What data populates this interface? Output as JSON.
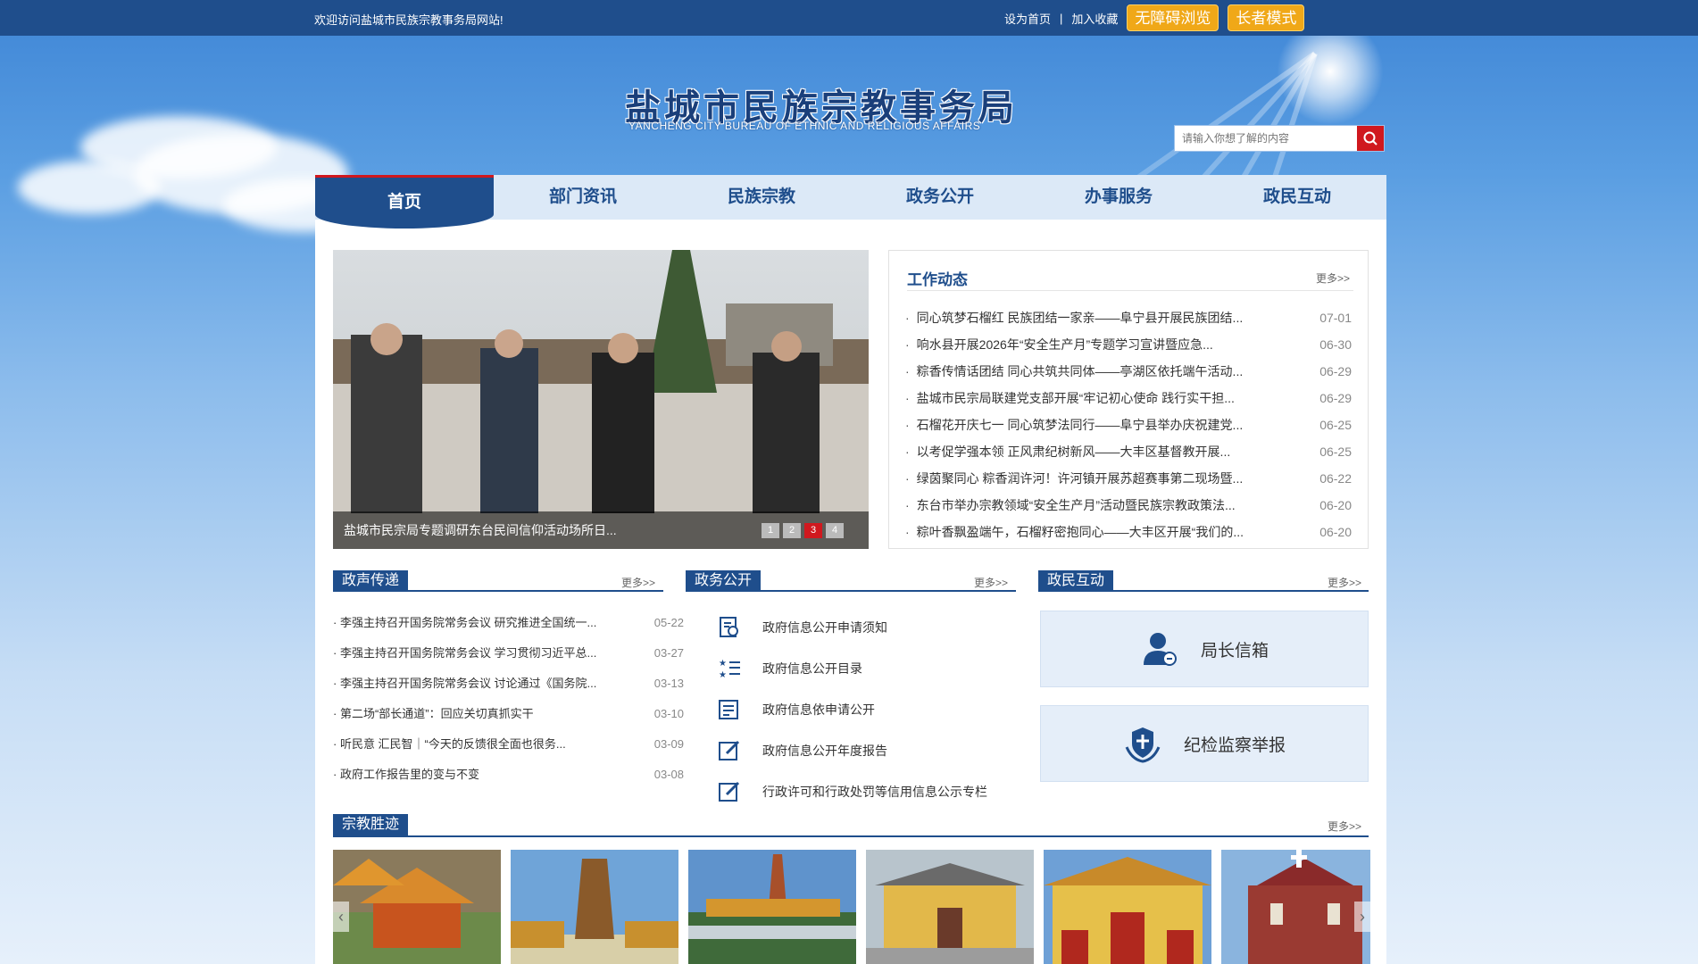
{
  "topbar": {
    "welcome": "欢迎访问盐城市民族宗教事务局网站!",
    "set_home": "设为首页",
    "separator": "|",
    "add_favorite": "加入收藏",
    "accessible_browse": "无障碍浏览",
    "elder_mode": "长者模式"
  },
  "header": {
    "title": "盐城市民族宗教事务局",
    "subtitle": "YANCHENG CITY BUREAU OF ETHNIC AND RELIGIOUS AFFAIRS",
    "search_placeholder": "请输入你想了解的内容"
  },
  "nav": [
    {
      "label": "首页",
      "active": true
    },
    {
      "label": "部门资讯",
      "active": false
    },
    {
      "label": "民族宗教",
      "active": false
    },
    {
      "label": "政务公开",
      "active": false
    },
    {
      "label": "办事服务",
      "active": false
    },
    {
      "label": "政民互动",
      "active": false
    }
  ],
  "slider": {
    "caption": "盐城市民宗局专题调研东台民间信仰活动场所日...",
    "pages": [
      "1",
      "2",
      "3",
      "4"
    ],
    "current": 3
  },
  "work_news": {
    "title": "工作动态",
    "more": "更多>>",
    "items": [
      {
        "title": "同心筑梦石榴红 民族团结一家亲——阜宁县开展民族团结...",
        "date": "07-01"
      },
      {
        "title": "响水县开展2026年“安全生产月”专题学习宣讲暨应急...",
        "date": "06-30"
      },
      {
        "title": "粽香传情话团结 同心共筑共同体——亭湖区依托端午活动...",
        "date": "06-29"
      },
      {
        "title": "盐城市民宗局联建党支部开展“牢记初心使命 践行实干担...",
        "date": "06-29"
      },
      {
        "title": "石榴花开庆七一 同心筑梦法同行——阜宁县举办庆祝建党...",
        "date": "06-25"
      },
      {
        "title": "以考促学强本领 正风肃纪树新风——大丰区基督教开展...",
        "date": "06-25"
      },
      {
        "title": "绿茵聚同心 粽香润许河！许河镇开展苏超赛事第二现场暨...",
        "date": "06-22"
      },
      {
        "title": "东台市举办宗教领域“安全生产月”活动暨民族宗教政策法...",
        "date": "06-20"
      },
      {
        "title": "粽叶香飘盈端午，石榴籽密抱同心——大丰区开展“我们的...",
        "date": "06-20"
      }
    ]
  },
  "gov_voice": {
    "title": "政声传递",
    "more": "更多>>",
    "items": [
      {
        "title": "· 李强主持召开国务院常务会议 研究推进全国统一...",
        "date": "05-22"
      },
      {
        "title": "· 李强主持召开国务院常务会议 学习贯彻习近平总...",
        "date": "03-27"
      },
      {
        "title": "· 李强主持召开国务院常务会议 讨论通过《国务院...",
        "date": "03-13"
      },
      {
        "title": "· 第二场“部长通道”：回应关切真抓实干",
        "date": "03-10"
      },
      {
        "title": "· 听民意 汇民智｜“今天的反馈很全面也很务...",
        "date": "03-09"
      },
      {
        "title": "· 政府工作报告里的变与不变",
        "date": "03-08"
      }
    ]
  },
  "gov_open": {
    "title": "政务公开",
    "more": "更多>>",
    "items": [
      {
        "label": "政府信息公开申请须知",
        "icon": "document-icon"
      },
      {
        "label": "政府信息公开目录",
        "icon": "list-icon"
      },
      {
        "label": "政府信息依申请公开",
        "icon": "form-icon"
      },
      {
        "label": "政府信息公开年度报告",
        "icon": "edit-icon"
      },
      {
        "label": "行政许可和行政处罚等信用信息公示专栏",
        "icon": "edit-icon"
      }
    ]
  },
  "interaction": {
    "title": "政民互动",
    "more": "更多>>",
    "director_mailbox": "局长信箱",
    "discipline_report": "纪检监察举报"
  },
  "religious_sites": {
    "title": "宗教胜迹",
    "more": "更多>>",
    "prev": "‹",
    "next": "›"
  },
  "colors": {
    "primary": "#1f4e8c",
    "accent_red": "#d0181e",
    "accent_yellow": "#f0a818",
    "nav_bg": "#dce9f7"
  }
}
